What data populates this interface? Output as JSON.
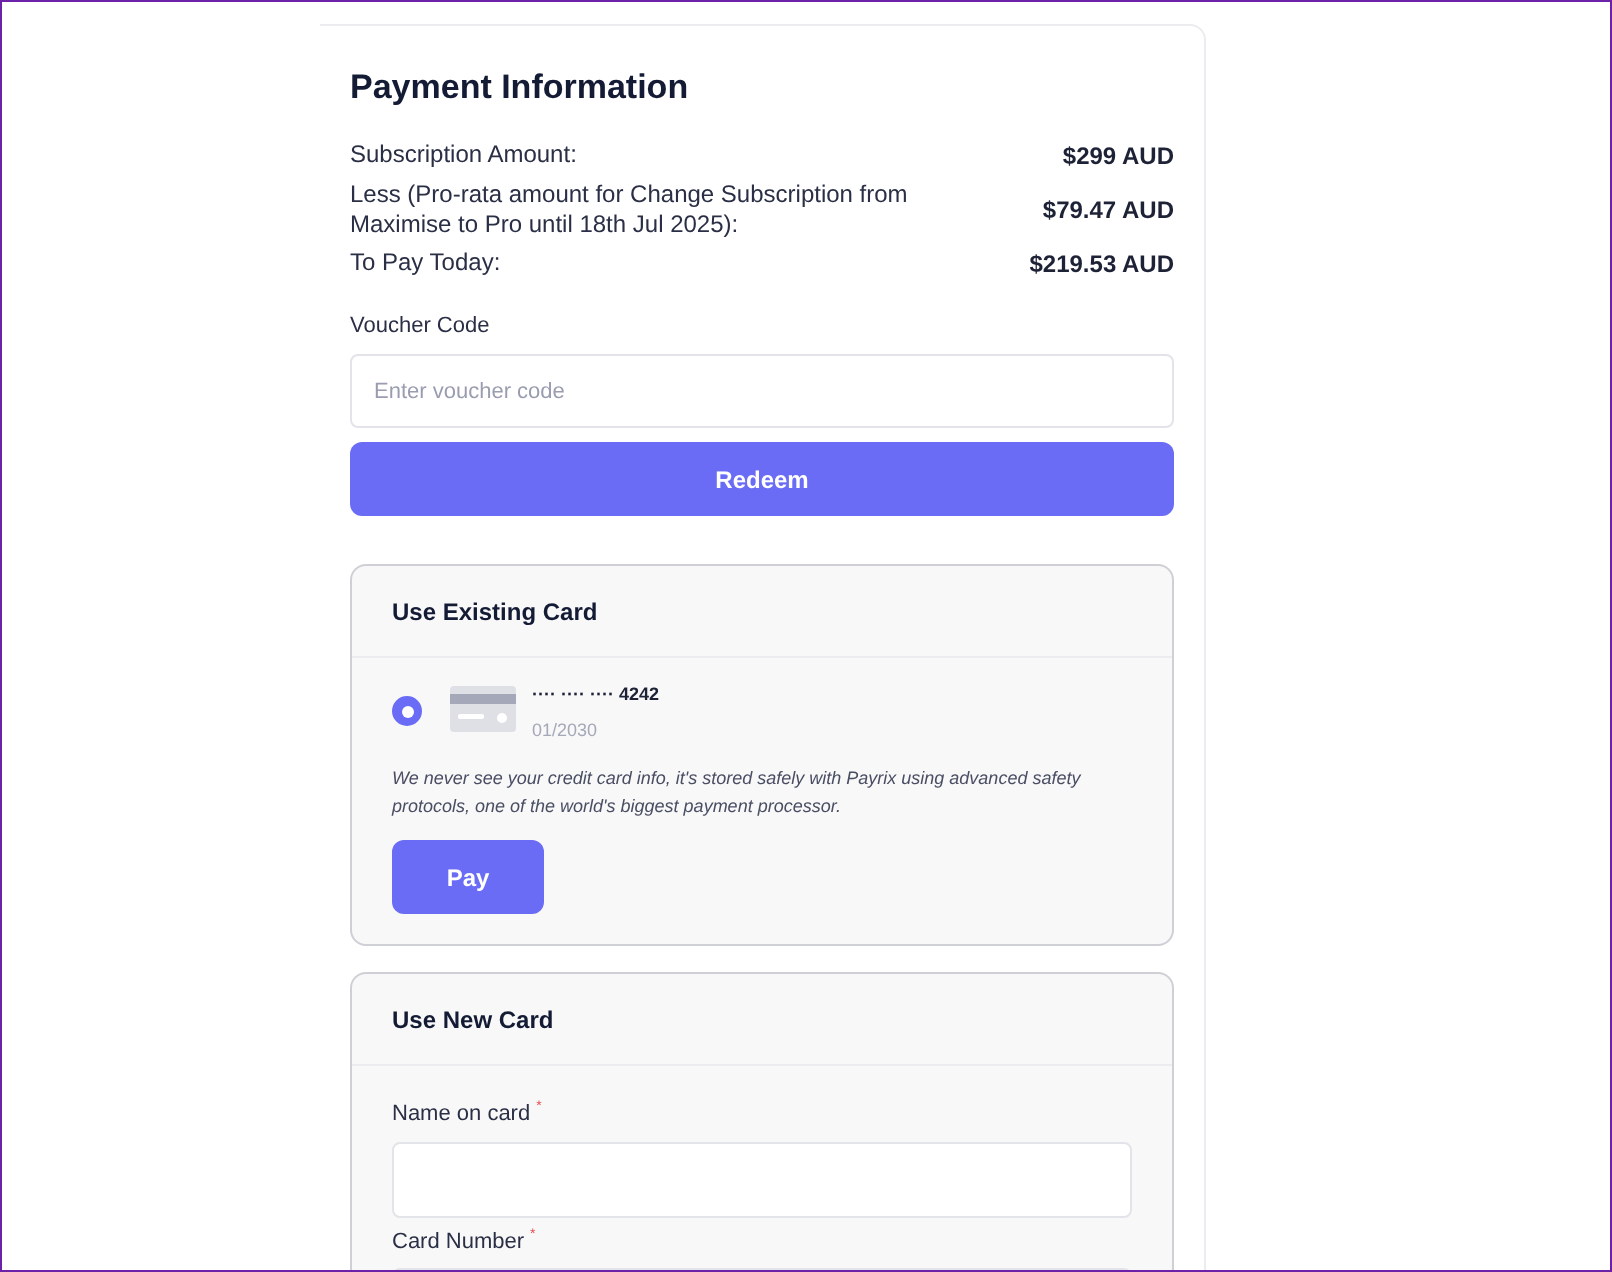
{
  "title": "Payment Information",
  "summary": [
    {
      "label": "Subscription Amount:",
      "value": "$299 AUD"
    },
    {
      "label": "Less (Pro-rata amount for Change Subscription from Maximise to Pro until 18th Jul 2025):",
      "value": "$79.47 AUD"
    },
    {
      "label": "To Pay Today:",
      "value": "$219.53 AUD"
    }
  ],
  "voucher": {
    "label": "Voucher Code",
    "placeholder": "Enter voucher code",
    "button": "Redeem"
  },
  "existing_card": {
    "title": "Use Existing Card",
    "card": {
      "number": "···· ···· ···· 4242",
      "expiry": "01/2030",
      "selected": true
    },
    "note": "We never see your credit card info, it's stored safely with Payrix using advanced safety protocols, one of the world's biggest payment processor.",
    "button": "Pay"
  },
  "new_card": {
    "title": "Use New Card",
    "fields": [
      {
        "label": "Name on card",
        "required_mark": "*"
      },
      {
        "label": "Card Number",
        "required_mark": "*"
      }
    ]
  }
}
